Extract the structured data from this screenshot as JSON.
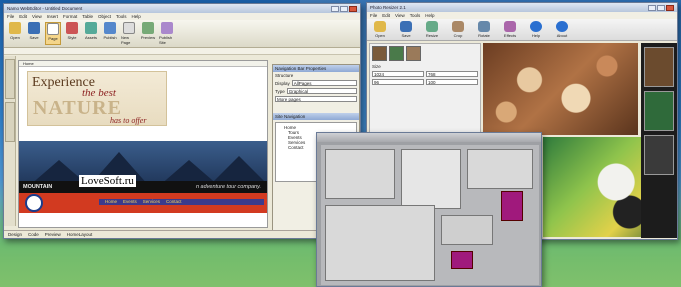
{
  "editor": {
    "title": "Namo WebEditor - Untitled Document",
    "menu": [
      "File",
      "Edit",
      "View",
      "Insert",
      "Format",
      "Table",
      "Object",
      "Tools",
      "Help"
    ],
    "toolbar": [
      "Open",
      "Save",
      "Page",
      "Style",
      "Assets",
      "Publish",
      "New Page",
      "Preview",
      "Publish Site"
    ],
    "doc_tab": "Home",
    "hero": {
      "line1": "Experience",
      "line2": "the best",
      "line3": "NATURE",
      "line4": "has to offer"
    },
    "brand": "MOUNTAIN",
    "brand_tag": "n adventure tour company.",
    "overlay": "LoveSoft.ru",
    "nav_items": [
      "Home",
      "Events",
      "Services",
      "Contact"
    ],
    "status": [
      "Design",
      "Code",
      "Preview",
      "HomeLayout"
    ],
    "props_title": "Navigation Bar Properties",
    "props": {
      "structure": "Structure",
      "display": "Display",
      "display_val": "AllPages",
      "type": "Type",
      "type_val": "Graphical",
      "more": "More pages"
    },
    "site_nav_title": "Site Navigation",
    "tree": [
      "Home",
      "Tours",
      "Events",
      "Services",
      "Contact"
    ]
  },
  "photo": {
    "title": "Photo Resizer 2.1",
    "menu": [
      "File",
      "Edit",
      "View",
      "Tools",
      "Help"
    ],
    "toolbar": [
      "Open",
      "Save",
      "Resize",
      "Crop",
      "Rotate",
      "Effects",
      "Help",
      "About"
    ],
    "left_label": "Size",
    "fields": [
      "1024",
      "768",
      "96",
      "100"
    ]
  },
  "icons": {
    "save": "save-icon",
    "open": "folder-icon",
    "page": "page-icon"
  }
}
